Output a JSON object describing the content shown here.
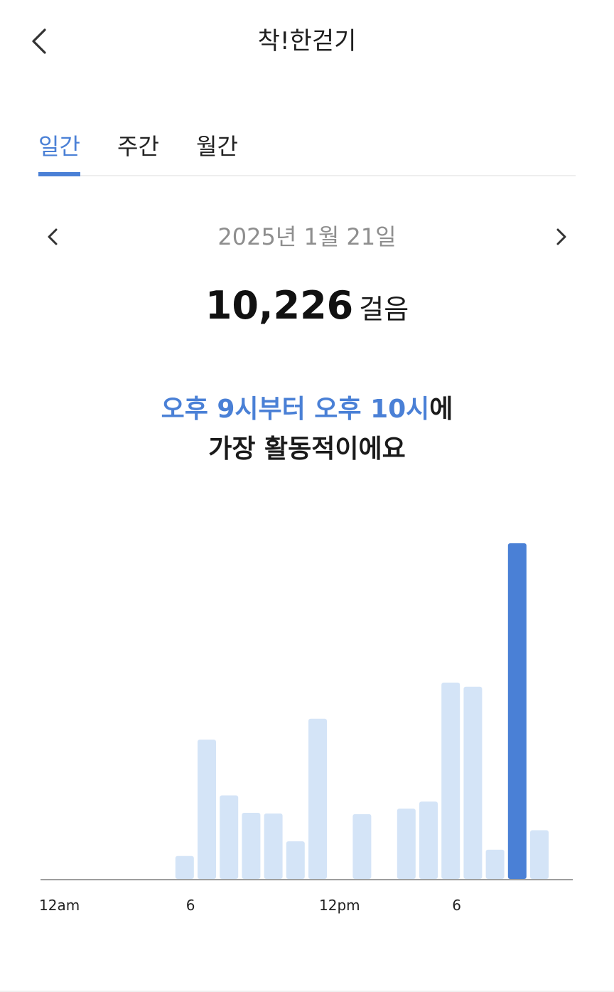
{
  "header": {
    "title": "착!한걷기",
    "back_icon": "chevron-left-icon"
  },
  "tabs": [
    {
      "label": "일간",
      "active": true
    },
    {
      "label": "주간",
      "active": false
    },
    {
      "label": "월간",
      "active": false
    }
  ],
  "date_nav": {
    "date": "2025년 1월 21일",
    "prev_icon": "chevron-left-icon",
    "next_icon": "chevron-right-icon"
  },
  "steps": {
    "value": "10,226",
    "unit": "걸음"
  },
  "summary": {
    "highlight_1": "오후 9시부터 오후 10시",
    "text_1": "에",
    "line_2": "가장 활동적이에요"
  },
  "colors": {
    "accent": "#4a80d6",
    "bar_light": "#d4e4f7",
    "bar_highlight": "#4a80d6",
    "axis": "#9e9e9e",
    "date_text": "#8e8e8e"
  },
  "chart_data": {
    "type": "bar",
    "categories": [
      "0",
      "1",
      "2",
      "3",
      "4",
      "5",
      "6",
      "7",
      "8",
      "9",
      "10",
      "11",
      "12",
      "13",
      "14",
      "15",
      "16",
      "17",
      "18",
      "19",
      "20",
      "21",
      "22",
      "23"
    ],
    "values": [
      0,
      0,
      0,
      0,
      0,
      0,
      33,
      200,
      120,
      95,
      94,
      54,
      230,
      0,
      93,
      0,
      101,
      111,
      282,
      276,
      42,
      482,
      70,
      0
    ],
    "highlight_index": 21,
    "tick_labels": [
      {
        "index": 0,
        "label": "12am"
      },
      {
        "index": 7,
        "label": "6"
      },
      {
        "index": 13,
        "label": "12pm"
      },
      {
        "index": 19,
        "label": "6"
      }
    ],
    "title": "",
    "xlabel": "",
    "ylabel": "",
    "grid": false
  }
}
